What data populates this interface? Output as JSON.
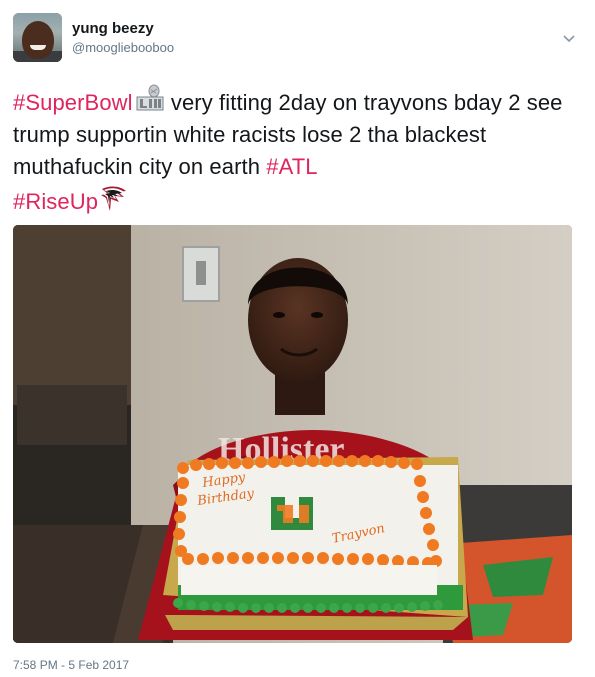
{
  "user": {
    "display_name": "yung beezy",
    "handle": "@moogliebooboo"
  },
  "tweet": {
    "segments": [
      {
        "text": "#SuperBowl",
        "type": "hashtag"
      },
      {
        "text": " very fitting 2day on trayvons bday 2 see trump supportin white racists lose 2 tha blackest muthafuckin city on earth ",
        "type": "text"
      },
      {
        "text": "#ATL",
        "type": "hashtag"
      },
      {
        "text": " ",
        "type": "text"
      },
      {
        "text": "#RiseUp",
        "type": "hashtag"
      }
    ],
    "timestamp": "7:58 PM - 5 Feb 2017"
  },
  "photo": {
    "cake_text_line1": "Happy",
    "cake_text_line2": "Birthday",
    "cake_logo_letter": "U",
    "cake_name": "Trayvon",
    "shirt_text": "Hollister"
  },
  "colors": {
    "hashtag": "#e0245e",
    "text": "#14171a",
    "secondary": "#657786"
  },
  "icons": [
    "chevron-down-icon",
    "superbowl-li-hashflag-icon",
    "falcons-hashflag-icon"
  ]
}
